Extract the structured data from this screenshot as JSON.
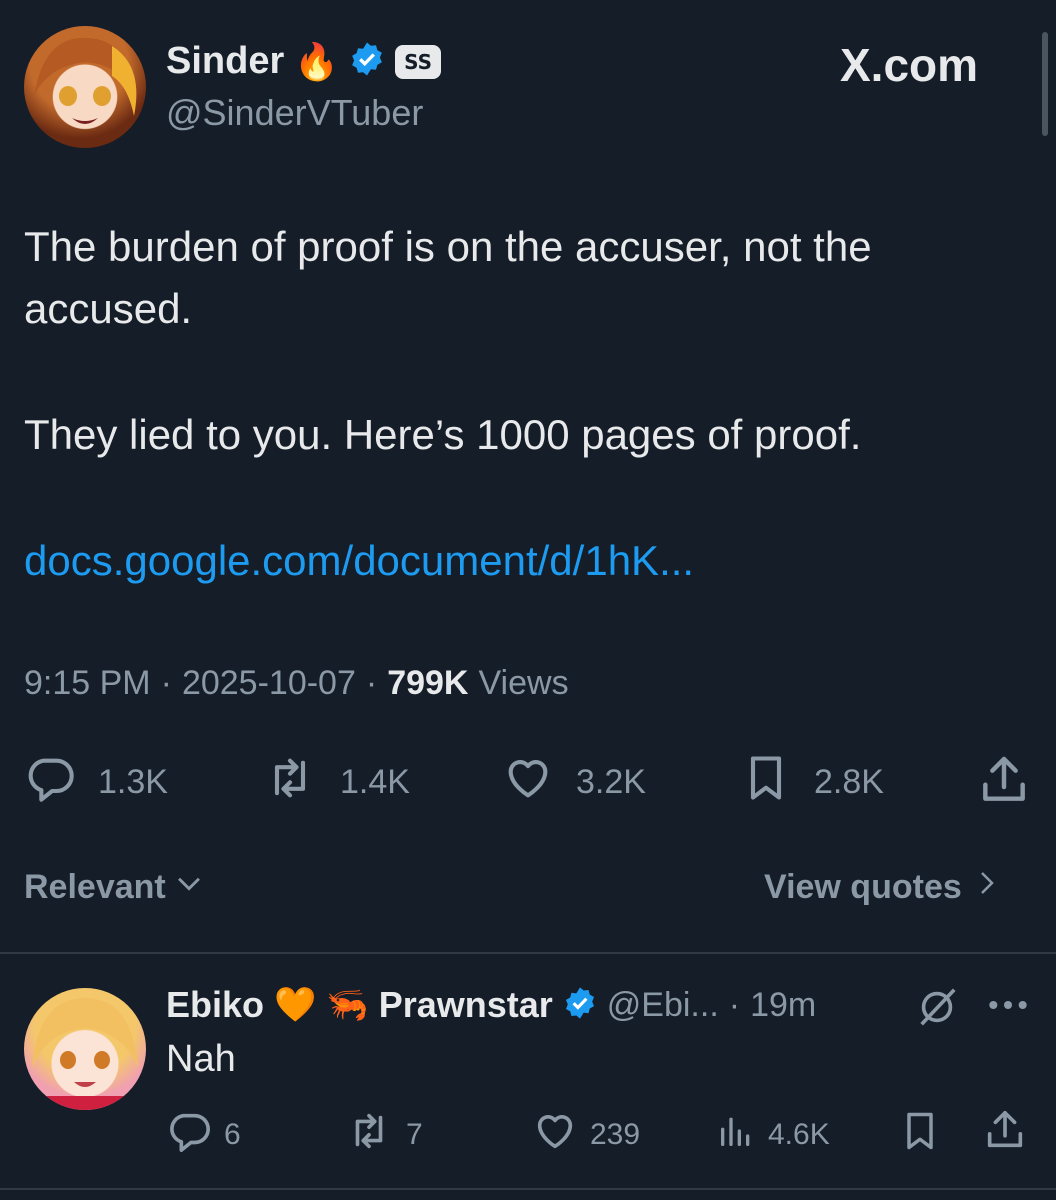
{
  "header": {
    "display_name": "Sinder",
    "name_emoji": "🔥",
    "handle": "@SinderVTuber",
    "affiliate_badge": "SS",
    "watermark": "X.com"
  },
  "tweet": {
    "paragraphs": [
      "The burden of proof is on the accuser, not the accused.",
      "They lied to you. Here’s 1000 pages of proof."
    ],
    "link_text": "docs.google.com/document/d/1hK...",
    "time": "9:15 PM",
    "date": "2025-10-07",
    "views_count": "799K",
    "views_label": "Views",
    "separator": "·"
  },
  "actions": {
    "replies": "1.3K",
    "reposts": "1.4K",
    "likes": "3.2K",
    "bookmarks": "2.8K"
  },
  "sort_bar": {
    "relevant_label": "Relevant",
    "view_quotes_label": "View quotes"
  },
  "reply": {
    "name_a": "Ebiko",
    "heart": "🧡",
    "shrimp": "🦐",
    "name_b": "Prawnstar",
    "handle": "@Ebi...",
    "time": "19m",
    "separator": "·",
    "text": "Nah",
    "replies": "6",
    "reposts": "7",
    "likes": "239",
    "views": "4.6K"
  },
  "colors": {
    "background": "#151d28",
    "text": "#e7e9ea",
    "muted": "#8b98a5",
    "link": "#1d9bf0",
    "verified": "#1d9bf0"
  },
  "icons": [
    "verified-badge-icon",
    "reply-icon",
    "repost-icon",
    "like-icon",
    "bookmark-icon",
    "share-icon",
    "chevron-down-icon",
    "chevron-right-icon",
    "grok-icon",
    "more-icon",
    "views-icon"
  ]
}
